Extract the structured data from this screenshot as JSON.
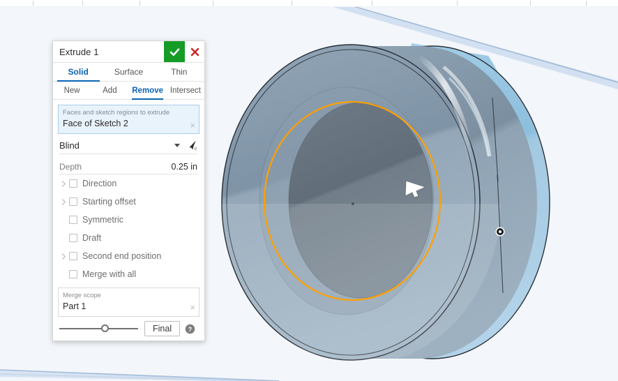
{
  "app": {
    "background_color": "#f3f6fa",
    "accent_color": "#0b63b6",
    "confirm_color": "#159c27",
    "cancel_color": "#cc2222",
    "highlight_sketch_color": "#ffa000"
  },
  "ruler": {
    "tick_positions": [
      47,
      118,
      200,
      305,
      418,
      533,
      655,
      760,
      840
    ]
  },
  "dialog": {
    "title": "Extrude 1",
    "confirm_icon": "check-icon",
    "cancel_icon": "close-icon",
    "primary_tabs": [
      {
        "label": "Solid",
        "active": true
      },
      {
        "label": "Surface",
        "active": false
      },
      {
        "label": "Thin",
        "active": false
      }
    ],
    "operation_tabs": [
      {
        "label": "New",
        "active": false
      },
      {
        "label": "Add",
        "active": false
      },
      {
        "label": "Remove",
        "active": true
      },
      {
        "label": "Intersect",
        "active": false
      }
    ],
    "selection": {
      "label": "Faces and sketch regions to extrude",
      "value": "Face of Sketch 2",
      "clear_icon": "×"
    },
    "end_condition": {
      "value": "Blind",
      "dropdown_icon": "chevron-down-icon",
      "pick_icon": "select-arrow-icon"
    },
    "depth": {
      "label": "Depth",
      "value": "0.25 in"
    },
    "options": [
      {
        "label": "Direction",
        "has_chevron": true,
        "checked": false
      },
      {
        "label": "Starting offset",
        "has_chevron": true,
        "checked": false
      },
      {
        "label": "Symmetric",
        "has_chevron": false,
        "checked": false
      },
      {
        "label": "Draft",
        "has_chevron": false,
        "checked": false
      },
      {
        "label": "Second end position",
        "has_chevron": true,
        "checked": false
      },
      {
        "label": "Merge with all",
        "has_chevron": false,
        "checked": false
      }
    ],
    "merge_scope": {
      "label": "Merge scope",
      "value": "Part 1",
      "clear_icon": "×"
    },
    "footer": {
      "slider_percent": 58,
      "final_button": "Final",
      "help_icon": "help-icon"
    }
  },
  "viewport": {
    "model_name": "cylindrical-hub-part",
    "cursor_icon": "pointer-arrow-cursor",
    "origin_marker": "vertex-point-marker",
    "colors": {
      "front_face": "#8195a8",
      "bore_face": "#6a7782",
      "rim_light": "#9bc7e2",
      "edge_line": "#2b3138",
      "sketch_highlight": "#ffa000",
      "plane_line": "#a8c0dd"
    }
  }
}
